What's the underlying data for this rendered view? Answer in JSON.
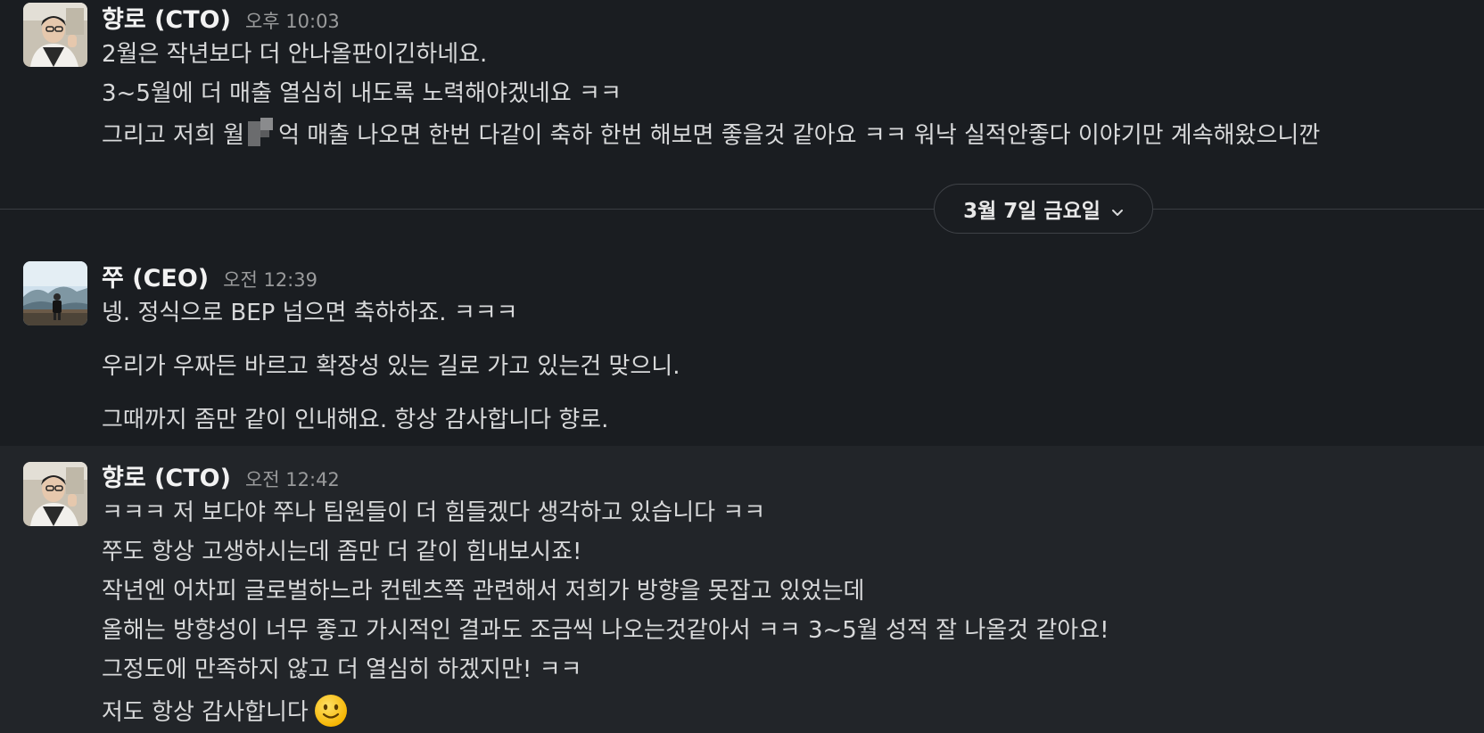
{
  "messages": [
    {
      "author": "향로 (CTO)",
      "time": "오후 10:03",
      "lines": [
        "2월은 작년보다 더 안나올판이긴하네요.",
        "3~5월에 더 매출 열심히 내도록 노력해야겠네요 ㅋㅋ",
        "그리고 저희 월",
        "억 매출 나오면 한번 다같이 축하 한번 해보면 좋을것 같아요 ㅋㅋ 워낙 실적안좋다 이야기만 계속해왔으니깐"
      ]
    },
    {
      "author": "쭈 (CEO)",
      "time": "오전 12:39",
      "lines": [
        "넹. 정식으로 BEP 넘으면 축하하죠. ㅋㅋㅋ",
        "우리가 우짜든 바르고 확장성 있는 길로 가고 있는건 맞으니.",
        "그때까지 좀만 같이 인내해요. 항상 감사합니다 향로."
      ]
    },
    {
      "author": "향로 (CTO)",
      "time": "오전 12:42",
      "lines": [
        "ㅋㅋㅋ 저 보다야 쭈나 팀원들이 더 힘들겠다 생각하고 있습니다 ㅋㅋ",
        "쭈도 항상 고생하시는데 좀만 더 같이 힘내보시죠!",
        "작년엔 어차피 글로벌하느라 컨텐츠쪽 관련해서 저희가 방향을 못잡고 있었는데",
        "올해는 방향성이 너무 좋고 가시적인 결과도 조금씩 나오는것같아서 ㅋㅋ 3~5월 성적 잘 나올것 같아요!",
        "그정도에 만족하지 않고 더 열심히 하겠지만! ㅋㅋ",
        "저도 항상 감사합니다"
      ]
    }
  ],
  "date_divider": {
    "label": "3월 7일 금요일",
    "icon": "chevron-down-icon"
  },
  "emoji": {
    "last_message": "slightly-smiling-face-icon"
  },
  "colors": {
    "background": "#1a1d21",
    "highlight_row": "#222529",
    "text": "#d8d9da",
    "timestamp": "#9a9b9c"
  }
}
